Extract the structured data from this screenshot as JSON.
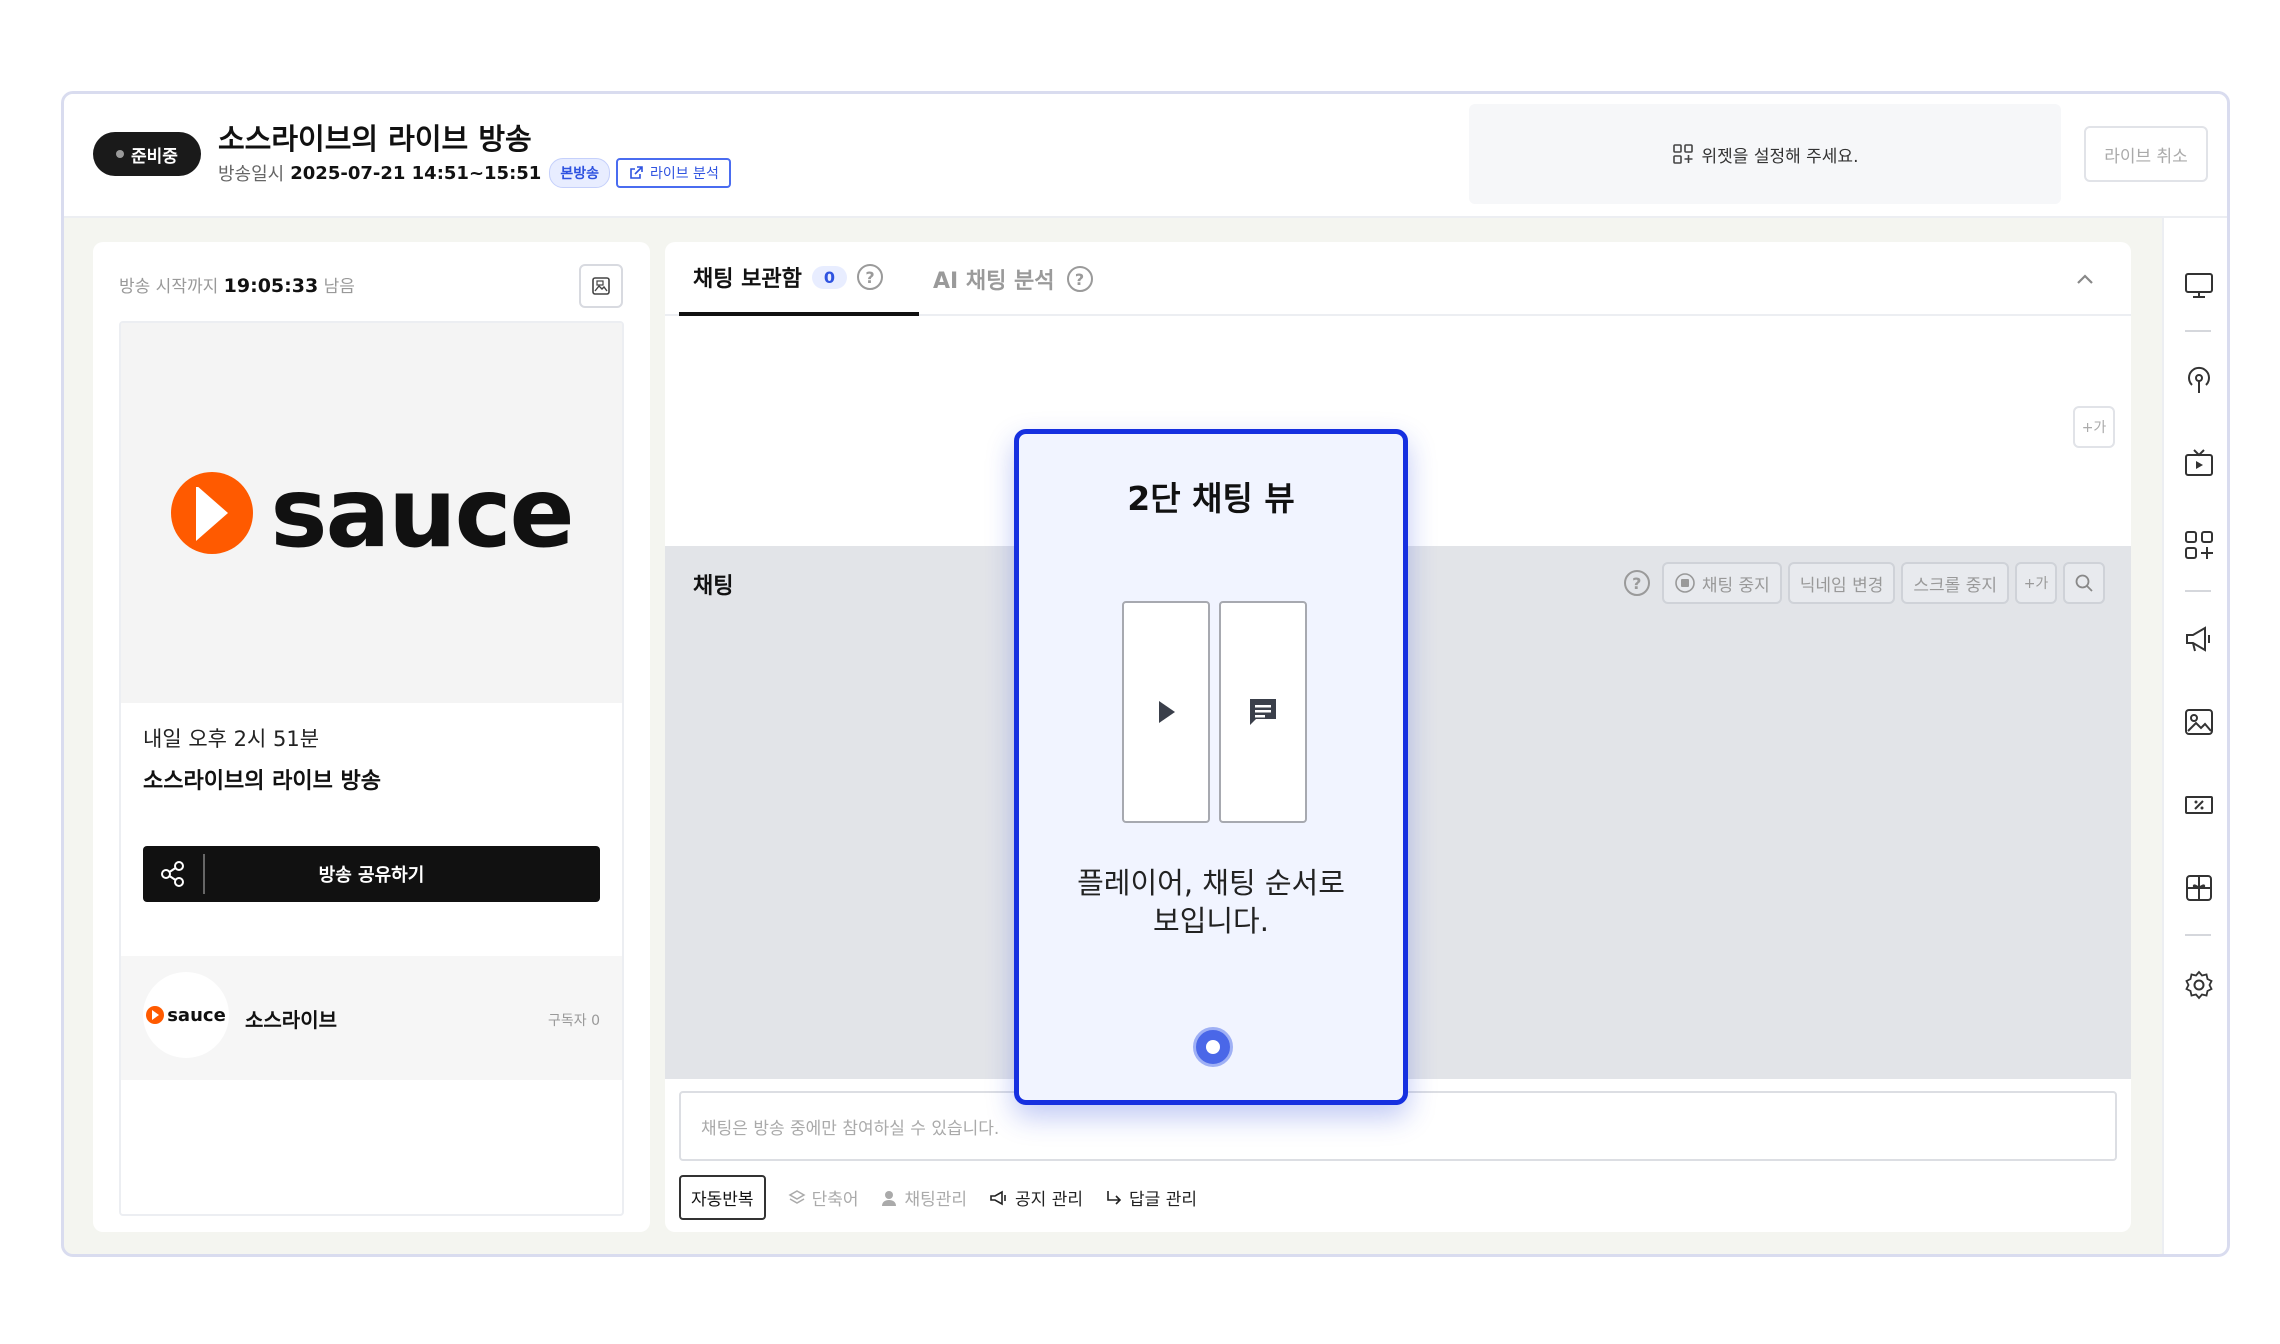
{
  "header": {
    "status": "준비중",
    "title": "소스라이브의 라이브 방송",
    "date_label": "방송일시",
    "date_value": "2025-07-21 14:51~15:51",
    "broadcast_type": "본방송",
    "analysis_link": "라이브 분석",
    "widget_notice": "위젯을 설정해 주세요.",
    "cancel_label": "라이브 취소"
  },
  "left": {
    "countdown_label": "방송 시작까지",
    "countdown_value": "19:05:33",
    "countdown_suffix": "남음",
    "logo_text": "sauce",
    "when": "내일 오후 2시 51분",
    "card_title": "소스라이브의 라이브 방송",
    "share_label": "방송 공유하기",
    "channel_logo_text": "sauce",
    "channel_name": "소스라이브",
    "subscribers": "구독자 0"
  },
  "chat": {
    "tab_archive": "채팅 보관함",
    "archive_count": "0",
    "tab_ai": "AI 채팅 분석",
    "font_btn": "+가",
    "chat_title": "채팅",
    "tools": {
      "stop": "채팅 중지",
      "nickname": "닉네임 변경",
      "scroll": "스크롤 중지",
      "font": "+가"
    },
    "input_placeholder": "채팅은 방송 중에만 참여하실 수 있습니다.",
    "bottom": {
      "auto_repeat": "자동반복",
      "shortcut": "단축어",
      "manage": "채팅관리",
      "notice": "공지 관리",
      "reply": "답글 관리"
    }
  },
  "popup": {
    "title": "2단 채팅 뷰",
    "desc_line1": "플레이어, 채팅 순서로",
    "desc_line2": "보입니다."
  },
  "colors": {
    "brand_orange": "#ff5a00",
    "accent_blue": "#1630e0",
    "badge_blue": "#2f53e0"
  }
}
